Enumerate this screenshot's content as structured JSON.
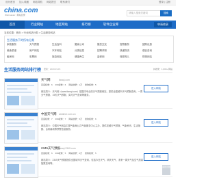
{
  "topbar": {
    "links": [
      "设为首页",
      "加入收藏",
      "网站导航",
      "网站提交",
      "联系我们"
    ],
    "login": "登录 | 注册"
  },
  "logo": {
    "text": "china.com",
    "subtitle": "Webmaster | 网站目录"
  },
  "search": {
    "placeholder": "请输入搜索关键词",
    "button": "搜索"
  },
  "nav": {
    "items": [
      "首页",
      "行业网站",
      "地区网站",
      "排行榜",
      "软件企业库"
    ],
    "active_index": 0,
    "apply_button": "申请收录"
  },
  "breadcrumb": "当前位置：首页 > 行业网站分类 > 生活服务网站",
  "categories": {
    "title": "生活服务下的所有分类",
    "items": [
      "家政服务",
      "天气预报",
      "生活百科",
      "搬家公司",
      "婚恋交友",
      "宠物服务",
      "团购优惠",
      "美食菜谱",
      "房产网站",
      "汽车网站",
      "分类信息",
      "招聘求职",
      "快递物流",
      "便民查询",
      "租房网",
      "彩票网",
      "旅游网站",
      "健康养生",
      "装修网",
      "母婴育儿",
      "购物网站"
    ]
  },
  "list_header": {
    "title": "生活服务网站排行榜",
    "updated": "更新：2023-03-15",
    "right": "共收录：1,000+ 网站"
  },
  "sites": [
    {
      "name": "天气网",
      "domain": "tianqi.com",
      "tags": [
        "百度权重：6",
        "360权重：6",
        "网站收录：1万",
        "搜狗权重：5"
      ],
      "intro": "网站简介：天气网（www.tianqi.com）是国内专业的天气预报网站，提供全国城市天气预报查询，一周天气预报、15天天气预报、实时天气查询等服务。",
      "visit": "进入网站"
    },
    {
      "name": "中国天气网",
      "domain": "weather.com.cn",
      "tags": [
        "百度权重：7",
        "360权重：7",
        "网站收录：5万",
        "搜狗权重：6"
      ],
      "intro": "网站简介：中国天气网由中国气象局公共气象服务中心主办，提供权威天气预报、气象资讯、生活指数、台风暴雨等预警信息服务。",
      "visit": "进入网站"
    },
    {
      "name": "2345天气预报",
      "domain": "tianqi.2345.com",
      "tags": [
        "百度权重：6",
        "360权重：5",
        "网站收录：2万",
        "搜狗权重：5"
      ],
      "intro": "网站简介：2345天气预报提供全国城市天气查询，包括今日天气、明天天气、未来一周天气及空气质量指数查询等。",
      "visit": "进入网站"
    }
  ],
  "backtop": "返回顶部"
}
